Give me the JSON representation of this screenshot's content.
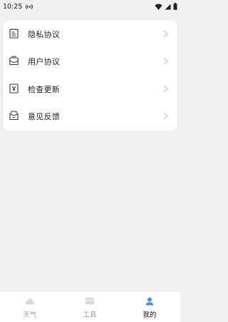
{
  "status_bar": {
    "time": "10:25",
    "icons": [
      "radio-icon",
      "wifi-icon",
      "signal-icon",
      "battery-icon"
    ]
  },
  "menu": {
    "items": [
      {
        "label": "隐私协议",
        "icon": "privacy-document-icon"
      },
      {
        "label": "用户协议",
        "icon": "user-agreement-mail-icon"
      },
      {
        "label": "检查更新",
        "icon": "update-check-icon"
      },
      {
        "label": "意见反馈",
        "icon": "feedback-icon"
      }
    ]
  },
  "tab_bar": {
    "active_color": "#4a8fe6",
    "tabs": [
      {
        "label": "天气",
        "icon": "weather-cloud-icon",
        "active": false
      },
      {
        "label": "工具",
        "icon": "tools-icon",
        "active": false
      },
      {
        "label": "我的",
        "icon": "profile-icon",
        "active": true
      }
    ]
  }
}
